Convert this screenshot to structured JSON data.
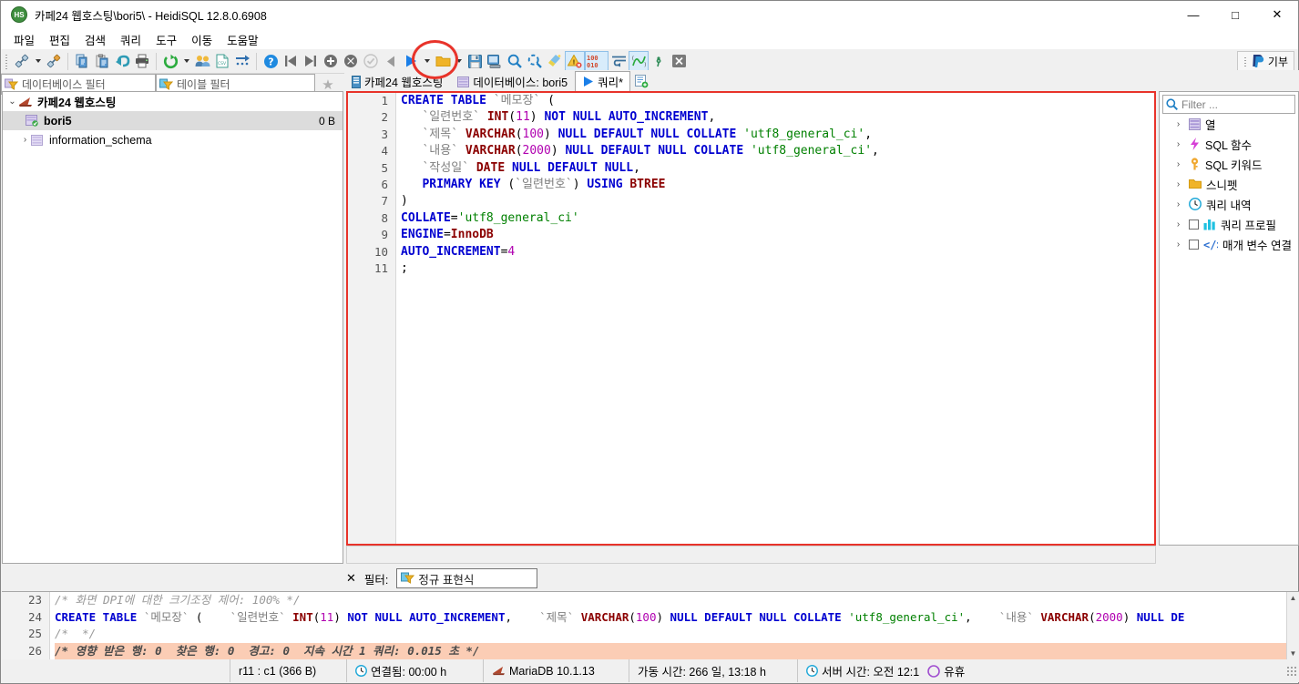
{
  "window": {
    "title": "카페24 웹호스팅\\bori5\\ - HeidiSQL 12.8.0.6908",
    "app_icon": "HS",
    "minimize": "—",
    "maximize": "□",
    "close": "✕"
  },
  "menu": [
    "파일",
    "편집",
    "검색",
    "쿼리",
    "도구",
    "이동",
    "도움말"
  ],
  "toolbar": {
    "donate_label": "기부",
    "items": [
      "connect-icon",
      "connect-dropdown",
      "disconnect-icon",
      "copy-icon",
      "paste-icon",
      "undo-icon",
      "print-icon",
      "refresh-icon",
      "refresh-dropdown",
      "users-icon",
      "csv-export-icon",
      "import-icon",
      "help-icon",
      "first-icon",
      "last-icon",
      "insert-row-icon",
      "delete-row-icon",
      "commit-icon",
      "stop-icon",
      "run-query-icon",
      "run-dropdown",
      "open-folder-icon",
      "open-dropdown",
      "save-icon",
      "save-as-icon",
      "find-icon",
      "replace-icon",
      "clean-icon",
      "error-icon",
      "line-numbers-icon",
      "word-wrap-icon",
      "format-icon",
      "delimiter-icon",
      "close-tab-icon"
    ]
  },
  "filters": {
    "database_filter_placeholder": "데이터베이스 필터",
    "table_filter_placeholder": "테이블 필터"
  },
  "tabs": [
    {
      "label": "카페24 웹호스팅",
      "icon": "server-icon",
      "active": false
    },
    {
      "label": "데이터베이스: bori5",
      "icon": "database-icon",
      "active": false
    },
    {
      "label": "쿼리*",
      "icon": "run-query-icon",
      "active": true
    }
  ],
  "tab_add_icon": "new-query-icon",
  "tree": [
    {
      "label": "카페24 웹호스팅",
      "size": "",
      "level": 0,
      "chevron": "⌄",
      "icon": "session-icon",
      "selected": false
    },
    {
      "label": "bori5",
      "size": "0 B",
      "level": 1,
      "chevron": "",
      "icon": "database-active-icon",
      "selected": true
    },
    {
      "label": "information_schema",
      "size": "",
      "level": 1,
      "chevron": "›",
      "icon": "database-icon",
      "selected": false
    }
  ],
  "editor": {
    "line_numbers": [
      "1",
      "2",
      "3",
      "4",
      "5",
      "6",
      "7",
      "8",
      "9",
      "10",
      "11"
    ],
    "lines": [
      [
        {
          "t": "CREATE TABLE ",
          "c": "kw"
        },
        {
          "t": "`메모장` ",
          "c": "ident"
        },
        {
          "t": "(",
          "c": "plain"
        }
      ],
      [
        {
          "t": "   ",
          "c": "plain"
        },
        {
          "t": "`일련번호` ",
          "c": "ident"
        },
        {
          "t": "INT",
          "c": "dt"
        },
        {
          "t": "(",
          "c": "plain"
        },
        {
          "t": "11",
          "c": "num"
        },
        {
          "t": ") ",
          "c": "plain"
        },
        {
          "t": "NOT NULL AUTO_INCREMENT",
          "c": "kw"
        },
        {
          "t": ",",
          "c": "plain"
        }
      ],
      [
        {
          "t": "   ",
          "c": "plain"
        },
        {
          "t": "`제목` ",
          "c": "ident"
        },
        {
          "t": "VARCHAR",
          "c": "dt"
        },
        {
          "t": "(",
          "c": "plain"
        },
        {
          "t": "100",
          "c": "num"
        },
        {
          "t": ") ",
          "c": "plain"
        },
        {
          "t": "NULL DEFAULT NULL COLLATE ",
          "c": "kw"
        },
        {
          "t": "'utf8_general_ci'",
          "c": "str"
        },
        {
          "t": ",",
          "c": "plain"
        }
      ],
      [
        {
          "t": "   ",
          "c": "plain"
        },
        {
          "t": "`내용` ",
          "c": "ident"
        },
        {
          "t": "VARCHAR",
          "c": "dt"
        },
        {
          "t": "(",
          "c": "plain"
        },
        {
          "t": "2000",
          "c": "num"
        },
        {
          "t": ") ",
          "c": "plain"
        },
        {
          "t": "NULL DEFAULT NULL COLLATE ",
          "c": "kw"
        },
        {
          "t": "'utf8_general_ci'",
          "c": "str"
        },
        {
          "t": ",",
          "c": "plain"
        }
      ],
      [
        {
          "t": "   ",
          "c": "plain"
        },
        {
          "t": "`작성일` ",
          "c": "ident"
        },
        {
          "t": "DATE",
          "c": "dt"
        },
        {
          "t": " ",
          "c": "plain"
        },
        {
          "t": "NULL DEFAULT NULL",
          "c": "kw"
        },
        {
          "t": ",",
          "c": "plain"
        }
      ],
      [
        {
          "t": "   ",
          "c": "plain"
        },
        {
          "t": "PRIMARY KEY ",
          "c": "kw"
        },
        {
          "t": "(",
          "c": "plain"
        },
        {
          "t": "`일련번호`",
          "c": "ident"
        },
        {
          "t": ") ",
          "c": "plain"
        },
        {
          "t": "USING ",
          "c": "kw"
        },
        {
          "t": "BTREE",
          "c": "dt"
        }
      ],
      [
        {
          "t": ")",
          "c": "plain"
        }
      ],
      [
        {
          "t": "COLLATE",
          "c": "kw"
        },
        {
          "t": "=",
          "c": "plain"
        },
        {
          "t": "'utf8_general_ci'",
          "c": "str"
        }
      ],
      [
        {
          "t": "ENGINE",
          "c": "kw"
        },
        {
          "t": "=",
          "c": "plain"
        },
        {
          "t": "InnoDB",
          "c": "dt"
        }
      ],
      [
        {
          "t": "AUTO_INCREMENT",
          "c": "kw"
        },
        {
          "t": "=",
          "c": "plain"
        },
        {
          "t": "4",
          "c": "num"
        }
      ],
      [
        {
          "t": ";",
          "c": "plain"
        }
      ]
    ]
  },
  "helper": {
    "filter_placeholder": "Filter ...",
    "items": [
      {
        "label": "열",
        "icon": "columns-icon",
        "checkbox": false
      },
      {
        "label": "SQL 함수",
        "icon": "function-icon",
        "checkbox": false
      },
      {
        "label": "SQL 키워드",
        "icon": "key-icon",
        "checkbox": false
      },
      {
        "label": "스니펫",
        "icon": "folder-icon",
        "checkbox": false
      },
      {
        "label": "쿼리 내역",
        "icon": "clock-icon",
        "checkbox": false
      },
      {
        "label": "쿼리 프로필",
        "icon": "chart-icon",
        "checkbox": true
      },
      {
        "label": "매개 변수 연결",
        "icon": "code-icon",
        "checkbox": true
      }
    ]
  },
  "log_filter": {
    "close_icon": "✕",
    "label": "필터:",
    "value": "정규 표현식"
  },
  "log": {
    "line_numbers": [
      "23",
      "24",
      "25",
      "26"
    ],
    "lines": [
      {
        "highlight": false,
        "parts": [
          {
            "t": "/* 화면 DPI에 대한 크기조정 제어: 100% */",
            "c": "cmt"
          }
        ]
      },
      {
        "highlight": false,
        "parts": [
          {
            "t": "CREATE TABLE ",
            "c": "kw"
          },
          {
            "t": "`메모장` ",
            "c": "ident"
          },
          {
            "t": "(    ",
            "c": "plain"
          },
          {
            "t": "`일련번호` ",
            "c": "ident"
          },
          {
            "t": "INT",
            "c": "dt"
          },
          {
            "t": "(",
            "c": "plain"
          },
          {
            "t": "11",
            "c": "num"
          },
          {
            "t": ") ",
            "c": "plain"
          },
          {
            "t": "NOT NULL AUTO_INCREMENT",
            "c": "kw"
          },
          {
            "t": ",    ",
            "c": "plain"
          },
          {
            "t": "`제목` ",
            "c": "ident"
          },
          {
            "t": "VARCHAR",
            "c": "dt"
          },
          {
            "t": "(",
            "c": "plain"
          },
          {
            "t": "100",
            "c": "num"
          },
          {
            "t": ") ",
            "c": "plain"
          },
          {
            "t": "NULL DEFAULT NULL COLLATE ",
            "c": "kw"
          },
          {
            "t": "'utf8_general_ci'",
            "c": "str"
          },
          {
            "t": ",    ",
            "c": "plain"
          },
          {
            "t": "`내용` ",
            "c": "ident"
          },
          {
            "t": "VARCHAR",
            "c": "dt"
          },
          {
            "t": "(",
            "c": "plain"
          },
          {
            "t": "2000",
            "c": "num"
          },
          {
            "t": ") ",
            "c": "plain"
          },
          {
            "t": "NULL DE",
            "c": "kw"
          }
        ]
      },
      {
        "highlight": false,
        "parts": [
          {
            "t": "/*  */",
            "c": "cmt"
          }
        ]
      },
      {
        "highlight": true,
        "parts": [
          {
            "t": "/* 영향 받은 행: 0  찾은 행: 0  경고: 0  지속 시간 1 쿼리: 0.015 초 */",
            "c": "cmt"
          }
        ]
      }
    ]
  },
  "status": [
    {
      "name": "cursor-position",
      "icon": "",
      "text": "r11 : c1 (366 B)"
    },
    {
      "name": "connection-uptime",
      "icon": "clock-icon",
      "text": "연결됨: 00:00 h"
    },
    {
      "name": "server-product",
      "icon": "session-icon",
      "text": "MariaDB 10.1.13"
    },
    {
      "name": "server-uptime",
      "icon": "",
      "text": "가동 시간: 266 일, 13:18 h"
    },
    {
      "name": "server-time",
      "icon": "clock-icon",
      "text": "서버 시간: 오전 12:1"
    },
    {
      "name": "idle-state",
      "icon": "circle-icon",
      "text": "유휴"
    }
  ],
  "colors": {
    "accent_red": "#e8332a",
    "keyword": "#0000d0",
    "datatype": "#8b0000",
    "number": "#b000b0",
    "string": "#008000",
    "identifier": "#808080",
    "highlight_row": "#fbcdb5"
  }
}
